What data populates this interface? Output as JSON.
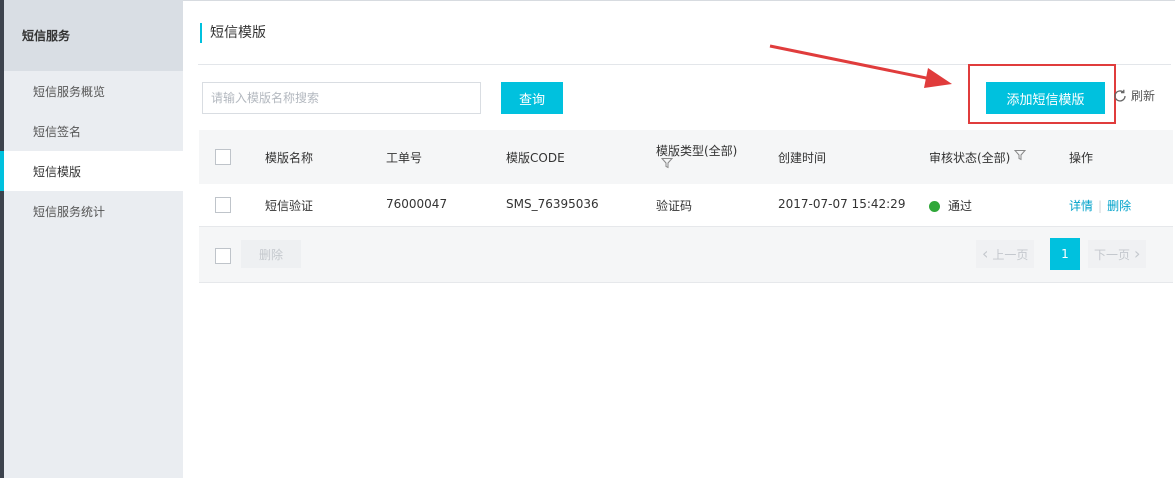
{
  "sidebar": {
    "header": "短信服务",
    "items": [
      {
        "label": "短信服务概览"
      },
      {
        "label": "短信签名"
      },
      {
        "label": "短信模版"
      },
      {
        "label": "短信服务统计"
      }
    ]
  },
  "page": {
    "title": "短信模版"
  },
  "search": {
    "placeholder": "请输入模版名称搜索",
    "button": "查询"
  },
  "toolbar": {
    "add_label": "添加短信模版",
    "refresh_label": "刷新"
  },
  "table": {
    "columns": {
      "name": "模版名称",
      "ticket": "工单号",
      "code": "模版CODE",
      "type": "模版类型(全部)",
      "created": "创建时间",
      "status": "审核状态(全部)",
      "actions": "操作"
    },
    "rows": [
      {
        "name": "短信验证",
        "ticket": "76000047",
        "code": "SMS_76395036",
        "type": "验证码",
        "created": "2017-07-07 15:42:29",
        "status": "通过",
        "detail": "详情",
        "delete": "删除"
      }
    ]
  },
  "footer": {
    "delete_label": "删除",
    "prev_label": "上一页",
    "page": "1",
    "next_label": "下一页"
  },
  "colors": {
    "accent": "#00c1de",
    "annotation": "#e03c3c",
    "status_ok": "#2fa739",
    "link": "#00a2ca"
  }
}
